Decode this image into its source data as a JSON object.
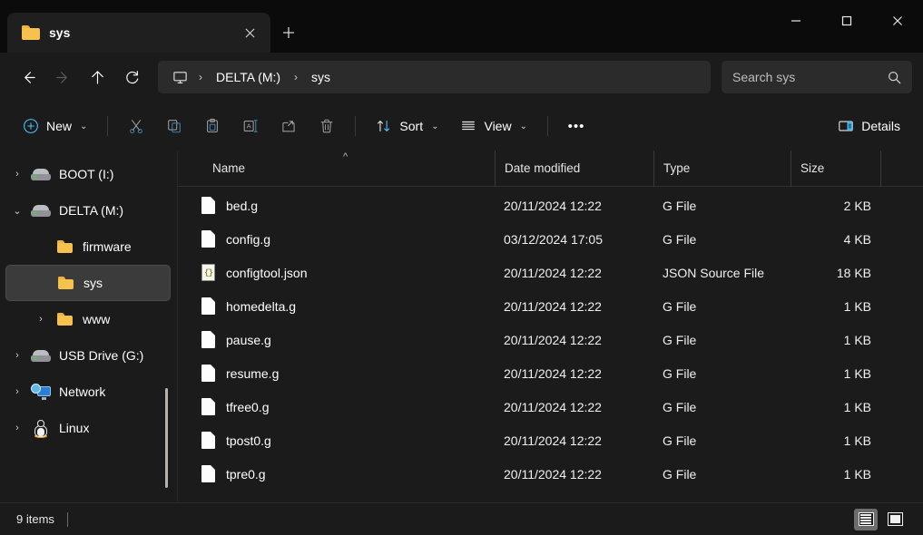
{
  "window": {
    "tab_title": "sys",
    "tab_icon": "folder-icon",
    "close_tab_glyph": "✕",
    "new_tab_glyph": "+",
    "minimize_glyph": "—",
    "maximize_glyph": "▢",
    "close_glyph": "✕"
  },
  "nav": {
    "back_glyph": "←",
    "forward_glyph": "→",
    "up_glyph": "↑",
    "refresh_glyph": "⟳"
  },
  "breadcrumb": {
    "root_icon": "this-pc-monitor-icon",
    "separator": "›",
    "items": [
      {
        "label": "DELTA (M:)"
      },
      {
        "label": "sys"
      }
    ]
  },
  "search": {
    "placeholder": "Search sys",
    "value": "",
    "icon": "search-icon"
  },
  "toolbar": {
    "new_label": "New",
    "new_icon": "plus-circle-icon",
    "cut_icon": "scissors-icon",
    "copy_icon": "copy-icon",
    "paste_icon": "clipboard-icon",
    "rename_icon": "rename-icon",
    "share_icon": "share-icon",
    "delete_icon": "trash-icon",
    "sort_label": "Sort",
    "sort_icon": "sort-arrows-icon",
    "view_label": "View",
    "view_icon": "view-lines-icon",
    "more_label": "•••",
    "details_label": "Details",
    "details_icon": "details-pane-icon",
    "chevron": "⌄",
    "accent_color": "#4cc2ff"
  },
  "sidebar": {
    "items": [
      {
        "label": "BOOT (I:)",
        "icon": "drive-icon",
        "twisty": "›",
        "level": 1,
        "selected": false
      },
      {
        "label": "DELTA (M:)",
        "icon": "drive-icon",
        "twisty": "⌄",
        "level": 1,
        "selected": false
      },
      {
        "label": "firmware",
        "icon": "folder-icon",
        "twisty": "",
        "level": 2,
        "selected": false
      },
      {
        "label": "sys",
        "icon": "folder-icon",
        "twisty": "",
        "level": 2,
        "selected": true
      },
      {
        "label": "www",
        "icon": "folder-icon",
        "twisty": "›",
        "level": 2,
        "selected": false
      },
      {
        "label": "USB Drive (G:)",
        "icon": "drive-icon",
        "twisty": "›",
        "level": 1,
        "selected": false
      },
      {
        "label": "Network",
        "icon": "network-icon",
        "twisty": "›",
        "level": 1,
        "selected": false
      },
      {
        "label": "Linux",
        "icon": "linux-penguin-icon",
        "twisty": "›",
        "level": 1,
        "selected": false
      }
    ]
  },
  "filelist": {
    "columns": [
      {
        "key": "name",
        "label": "Name"
      },
      {
        "key": "date",
        "label": "Date modified"
      },
      {
        "key": "type",
        "label": "Type"
      },
      {
        "key": "size",
        "label": "Size"
      }
    ],
    "sort_indicator": "^",
    "rows": [
      {
        "name": "bed.g",
        "date": "20/11/2024 12:22",
        "type": "G File",
        "size": "2 KB",
        "icon": "document-icon"
      },
      {
        "name": "config.g",
        "date": "03/12/2024 17:05",
        "type": "G File",
        "size": "4 KB",
        "icon": "document-icon"
      },
      {
        "name": "configtool.json",
        "date": "20/11/2024 12:22",
        "type": "JSON Source File",
        "size": "18 KB",
        "icon": "json-file-icon"
      },
      {
        "name": "homedelta.g",
        "date": "20/11/2024 12:22",
        "type": "G File",
        "size": "1 KB",
        "icon": "document-icon"
      },
      {
        "name": "pause.g",
        "date": "20/11/2024 12:22",
        "type": "G File",
        "size": "1 KB",
        "icon": "document-icon"
      },
      {
        "name": "resume.g",
        "date": "20/11/2024 12:22",
        "type": "G File",
        "size": "1 KB",
        "icon": "document-icon"
      },
      {
        "name": "tfree0.g",
        "date": "20/11/2024 12:22",
        "type": "G File",
        "size": "1 KB",
        "icon": "document-icon"
      },
      {
        "name": "tpost0.g",
        "date": "20/11/2024 12:22",
        "type": "G File",
        "size": "1 KB",
        "icon": "document-icon"
      },
      {
        "name": "tpre0.g",
        "date": "20/11/2024 12:22",
        "type": "G File",
        "size": "1 KB",
        "icon": "document-icon"
      }
    ]
  },
  "statusbar": {
    "item_count": "9 items",
    "details_view_icon": "details-view-icon",
    "large-icons_view_icon": "large-icons-view-icon",
    "active_view": "details"
  }
}
